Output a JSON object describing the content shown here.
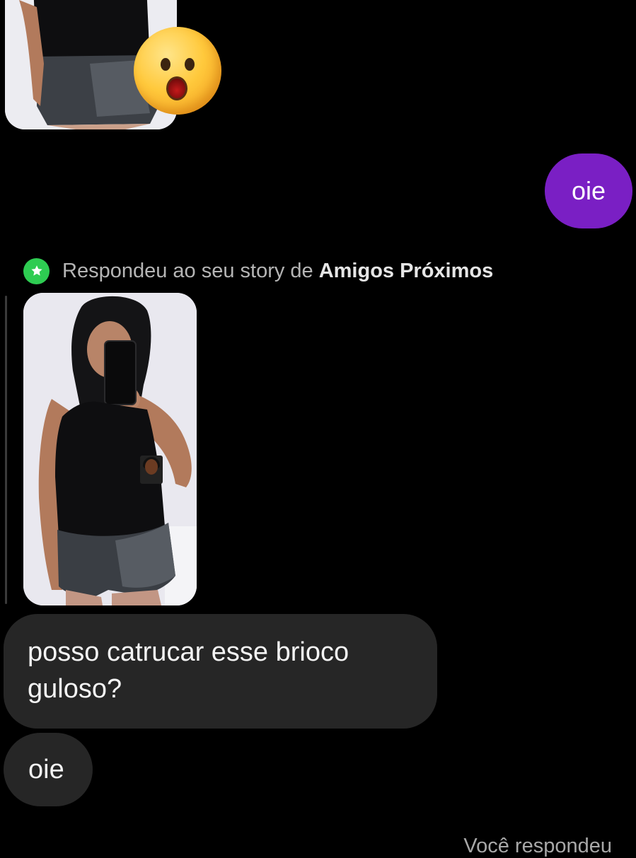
{
  "thread": {
    "top_story": {
      "reaction_emoji": "astonished-face-icon"
    },
    "sent_message": {
      "text": "oie"
    },
    "story_reply_context": {
      "prefix": "Respondeu ao seu story de",
      "audience": "Amigos Próximos",
      "icon": "close-friends-star-icon"
    },
    "received_messages": [
      {
        "text": "posso catrucar esse brioco guloso?"
      },
      {
        "text": "oie"
      }
    ],
    "bottom_status": "Você respondeu"
  },
  "colors": {
    "background": "#000000",
    "sent_bubble": "#7a1fc4",
    "received_bubble": "#262626",
    "close_friends": "#2ecc52",
    "muted_text": "#b5b5b5"
  }
}
